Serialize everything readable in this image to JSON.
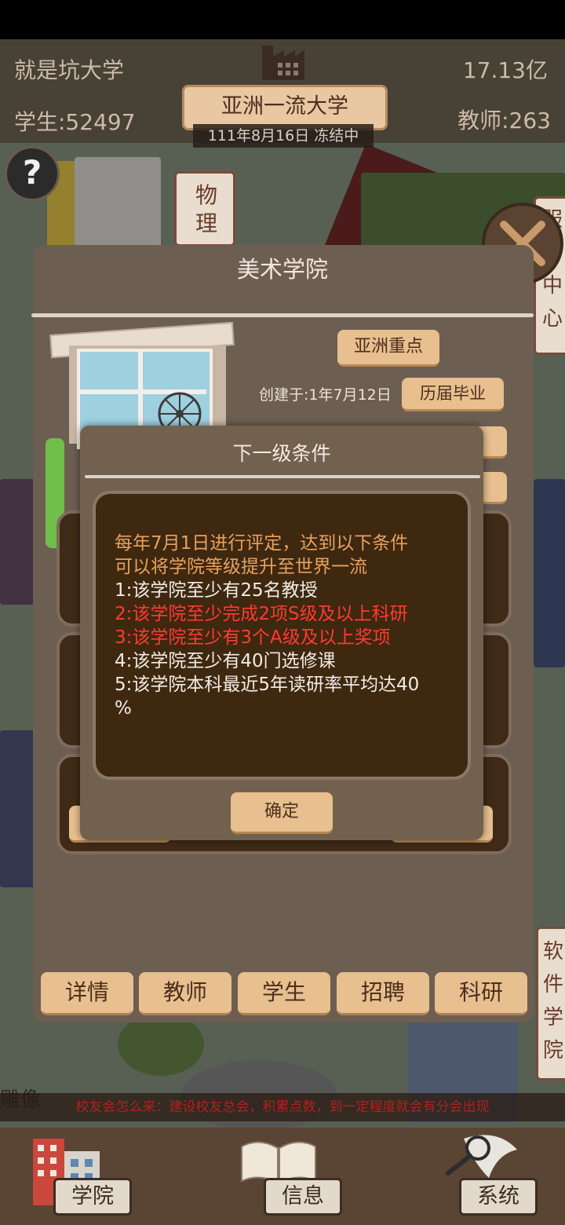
{
  "header": {
    "school_name": "就是坑大学",
    "money": "17.13亿",
    "students": "学生:52497",
    "teachers": "教师:263",
    "rank_banner": "亚洲一流大学",
    "date_status": "111年8月16日 冻结中"
  },
  "scene_labels": {
    "physics": "物理",
    "right_building_1": "服务中心",
    "right_building_2": "软件学院",
    "statue": "雕像"
  },
  "college": {
    "title": "美术学院",
    "level_button": "亚洲重点",
    "created": "创建于:1年7月12日",
    "graduates_button": "历届毕业",
    "tabs": [
      "详情",
      "教师",
      "学生",
      "招聘",
      "科研"
    ]
  },
  "modal": {
    "title": "下一级条件",
    "intro_line1": "每年7月1日进行评定，达到以下条件",
    "intro_line2": "可以将学院等级提升至世界一流",
    "cond1": "1:该学院至少有25名教授",
    "cond2": "2:该学院至少完成2项S级及以上科研",
    "cond3": "3:该学院至少有3个A级及以上奖项",
    "cond4": "4:该学院至少有40门选修课",
    "cond5_line1": "5:该学院本科最近5年读研率平均达40",
    "cond5_line2": "%",
    "confirm": "确定"
  },
  "tip": "校友会怎么来：建设校友总会，积累点数，到一定程度就会有分会出现",
  "bottom_nav": {
    "college": "学院",
    "info": "信息",
    "system": "系统"
  },
  "colors": {
    "intro_text": "#e9a15e",
    "met_text": "#f2ece4",
    "unmet_text": "#ff3b30",
    "button": "#e8bf8f"
  },
  "icons": [
    "help-icon",
    "close-icon",
    "factory-icon",
    "ferris-wheel-icon",
    "college-building-icon",
    "book-icon",
    "magnifier-icon"
  ]
}
